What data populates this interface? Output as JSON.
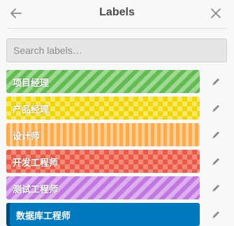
{
  "header": {
    "title": "Labels",
    "back_icon": "arrow-left-icon",
    "close_icon": "close-icon"
  },
  "search": {
    "placeholder": "Search labels…",
    "value": ""
  },
  "labels": [
    {
      "name": "项目经理",
      "color": "#61bd4f",
      "pattern": "diagonal-stripes",
      "selected": false
    },
    {
      "name": "产品经理",
      "color": "#f2d600",
      "pattern": "checker",
      "selected": false
    },
    {
      "name": "设计师",
      "color": "#ffab4a",
      "pattern": "vertical-stripes",
      "selected": false
    },
    {
      "name": "开发工程师",
      "color": "#eb5a46",
      "pattern": "checker",
      "selected": false
    },
    {
      "name": "测试工程师",
      "color": "#c377e0",
      "pattern": "diagonal-stripes",
      "selected": false
    },
    {
      "name": "数据库工程师",
      "color": "#0079bf",
      "pattern": "solid",
      "selected": true
    }
  ],
  "edit_icon": "pencil-icon"
}
